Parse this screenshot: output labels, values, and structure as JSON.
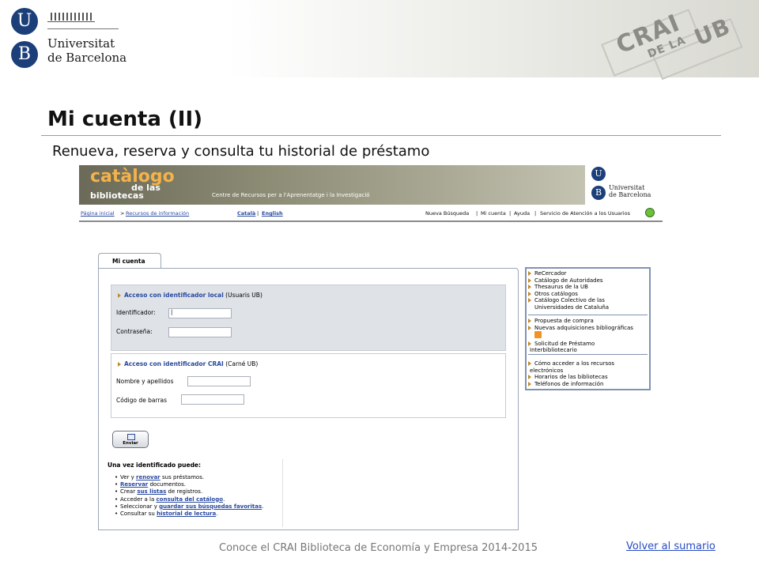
{
  "header": {
    "ub_logo_letter_top": "U",
    "ub_logo_letter_bottom": "B",
    "ub_name_line1": "Universitat",
    "ub_name_line2": "de Barcelona",
    "crai_logo_top": "CRAI",
    "crai_logo_mid": "DE LA",
    "crai_logo_right": "UB"
  },
  "slide": {
    "title": "Mi cuenta (II)",
    "subtitle": "Renueva, reserva y consulta tu historial de préstamo"
  },
  "catalog": {
    "header": {
      "title_line1": "catàlogo",
      "title_line2": "de las",
      "title_line3": "bibliotecas",
      "centre_text": "Centre de Recursos per a l'Aprenentatge i la Investigació",
      "ub_letter_top": "U",
      "ub_letter_bottom": "B",
      "ub_name_line1": "Universitat",
      "ub_name_line2": "de Barcelona"
    },
    "breadcrumb": {
      "home": "Página inicial",
      "separator": ">",
      "resources": "Recursos de información"
    },
    "languages": {
      "catala": "Català",
      "separator": "|",
      "english": "English"
    },
    "top_nav": [
      "Nueva Búsqueda",
      "|",
      "Mi cuenta",
      "|",
      "Ayuda",
      "|",
      "Servicio de Atención a los Usuarios"
    ],
    "tab_label": "Mi cuenta",
    "local_login": {
      "heading": "Acceso con identificador local",
      "heading_note": "(Usuaris UB)",
      "id_label": "Identificador:",
      "id_value": "|",
      "password_label": "Contraseña:",
      "password_value": ""
    },
    "crai_login": {
      "heading": "Acceso con identificador CRAI",
      "heading_note": "(Carné UB)",
      "name_label": "Nombre y apellidos",
      "name_value": "",
      "barcode_label": "Código de barras",
      "barcode_value": ""
    },
    "submit_label": "Enviar",
    "info": {
      "title": "Una vez identificado puede:",
      "items": [
        {
          "pre": "Ver y ",
          "link": "renovar",
          "post": " sus préstamos."
        },
        {
          "pre": "",
          "link": "Reservar",
          "post": " documentos."
        },
        {
          "pre": "Crear ",
          "link": "sus listas",
          "post": " de registros."
        },
        {
          "pre": "Acceder a la ",
          "link": "consulta del catálogo",
          "post": "."
        },
        {
          "pre": "Seleccionar y ",
          "link": "guardar sus búsquedas favoritas",
          "post": "."
        },
        {
          "pre": "Consultar su ",
          "link": "historial de lectura",
          "post": "."
        }
      ]
    },
    "sidebar": {
      "group1": [
        "ReCercador",
        "Catálogo de Autoridades",
        "Thesaurus de la UB",
        "Otros catálogos",
        "Catálogo Colectivo de las",
        "Universidades de Cataluña"
      ],
      "group2": [
        "Propuesta de compra",
        "Nuevas adquisiciones bibliográficas"
      ],
      "group3": [
        "Solicitud de Préstamo",
        "Interbibliotecario"
      ],
      "group4": [
        "Cómo acceder a los recursos",
        "electrónicos",
        "Horarios de las bibliotecas",
        "Teléfonos de información"
      ]
    }
  },
  "footer": {
    "text": "Conoce el CRAI Biblioteca de Economía y Empresa 2014-2015",
    "link": "Volver al sumario"
  },
  "colors": {
    "ub_blue": "#1c3f7a",
    "catalog_orange": "#f4b24a",
    "link_blue": "#2a4aa0",
    "footer_link": "#2a4cc4"
  }
}
